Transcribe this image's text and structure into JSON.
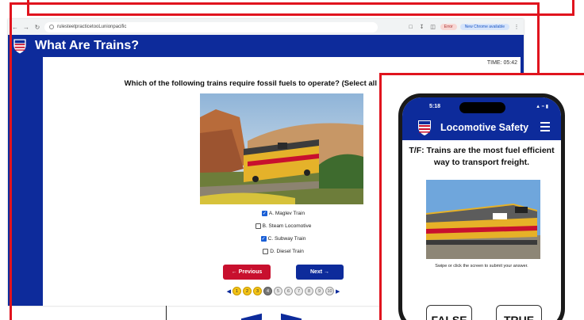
{
  "browser": {
    "url": "rulesteetpracticetooLunionpacific",
    "profile_label": "Error",
    "update_label": "New Chrome available"
  },
  "quiz": {
    "app_title": "What Are Trains?",
    "timer": "TIME: 05:42",
    "question": "Which of the following trains require fossil fuels to operate? (Select all Correct Choices):",
    "choices": [
      {
        "label": "A. Maglev Train",
        "checked": true
      },
      {
        "label": "B. Steam Locomotive",
        "checked": false
      },
      {
        "label": "C. Subway Train",
        "checked": true
      },
      {
        "label": "D. Diesel Train",
        "checked": false
      }
    ],
    "prev_label": "← Previous",
    "next_label": "Next →",
    "pages": [
      "1",
      "2",
      "3",
      "4",
      "5",
      "6",
      "7",
      "8",
      "9",
      "10"
    ],
    "completed_pages": 3,
    "current_page": 4
  },
  "phone": {
    "status_time": "5:18",
    "app_title": "Locomotive Safety",
    "question": "T/F: Trains are the most fuel efficient way to transport freight.",
    "instruction": "Swipe or click the screen to submit your answer.",
    "false_label": "FALSE",
    "true_label": "TRUE"
  },
  "colors": {
    "brand_blue": "#0d2b9b",
    "brand_red": "#c8102e",
    "highlight_red": "#e0141e",
    "completed_yellow": "#f3c316"
  },
  "icons": [
    "back-arrow-icon",
    "forward-arrow-icon",
    "reload-icon",
    "union-pacific-shield-icon",
    "hamburger-menu-icon",
    "checkbox-icon",
    "chevron-left-icon",
    "chevron-right-icon"
  ]
}
